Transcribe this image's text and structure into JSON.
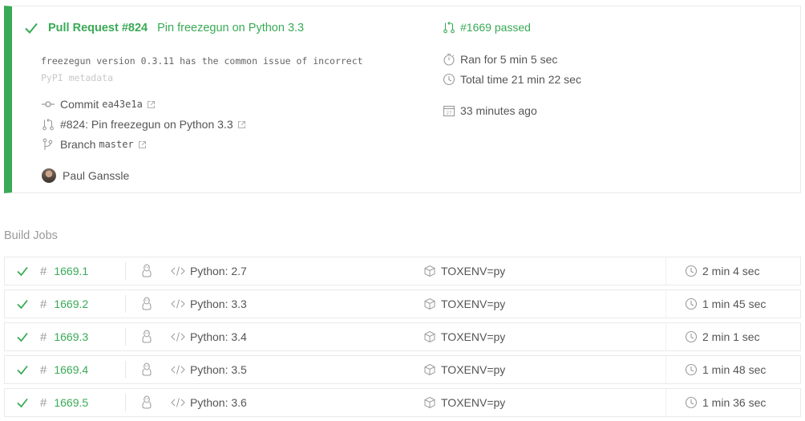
{
  "build": {
    "pr_label": "Pull Request #824",
    "pr_title": "Pin freezegun on Python 3.3",
    "commit_message_line1": "freezegun version 0.3.11 has the common issue of incorrect",
    "commit_message_line2": "PyPI metadata",
    "commit_label": "Commit",
    "commit_sha": "ea43e1a",
    "pr_link": "#824: Pin freezegun on Python 3.3",
    "branch_label": "Branch",
    "branch_name": "master",
    "author": "Paul Ganssle",
    "build_status": "#1669 passed",
    "ran_for": "Ran for 5 min 5 sec",
    "total_time": "Total time 21 min 22 sec",
    "finished": "33 minutes ago",
    "status_color": "#39aa56"
  },
  "section_title": "Build Jobs",
  "jobs": [
    {
      "number": "1669.1",
      "language": "Python: 2.7",
      "env": "TOXENV=py",
      "duration": "2 min 4 sec",
      "os_icon": "linux-icon"
    },
    {
      "number": "1669.2",
      "language": "Python: 3.3",
      "env": "TOXENV=py",
      "duration": "1 min 45 sec",
      "os_icon": "linux-icon"
    },
    {
      "number": "1669.3",
      "language": "Python: 3.4",
      "env": "TOXENV=py",
      "duration": "2 min 1 sec",
      "os_icon": "linux-icon"
    },
    {
      "number": "1669.4",
      "language": "Python: 3.5",
      "env": "TOXENV=py",
      "duration": "1 min 48 sec",
      "os_icon": "linux-icon"
    },
    {
      "number": "1669.5",
      "language": "Python: 3.6",
      "env": "TOXENV=py",
      "duration": "1 min 36 sec",
      "os_icon": "linux-icon"
    }
  ]
}
